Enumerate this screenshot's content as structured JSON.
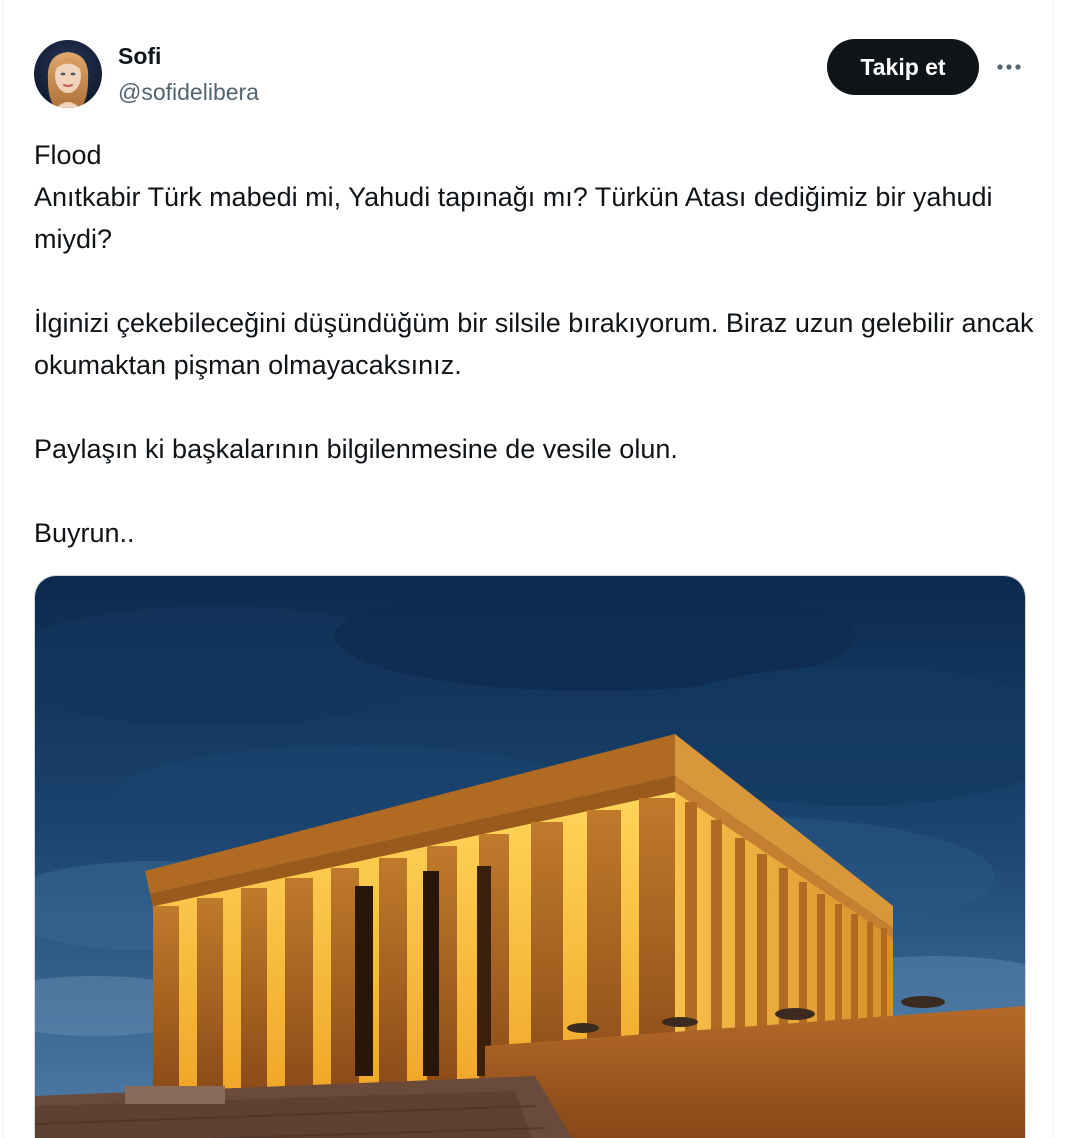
{
  "tweet": {
    "author": {
      "display_name": "Sofi",
      "handle": "@sofidelibera",
      "avatar_icon": "profile-photo"
    },
    "follow_label": "Takip et",
    "more_icon": "ellipsis-icon",
    "text": {
      "line1": "Flood",
      "line2": "Anıtkabir Türk mabedi mi, Yahudi tapınağı mı? Türkün Atası dediğimiz bir yahudi miydi?",
      "para2": "İlginizi çekebileceğini düşündüğüm bir silsile bırakıyorum. Biraz uzun gelebilir ancak okumaktan pişman olmayacaksınız.",
      "para3": "Paylaşın ki başkalarının bilgilenmesine de vesile olun.",
      "para4": "Buyrun.."
    },
    "media": {
      "type": "photo"
    }
  },
  "colors": {
    "text_primary": "#0f1419",
    "text_secondary": "#536471",
    "button_bg": "#0f1419",
    "button_text": "#ffffff"
  }
}
